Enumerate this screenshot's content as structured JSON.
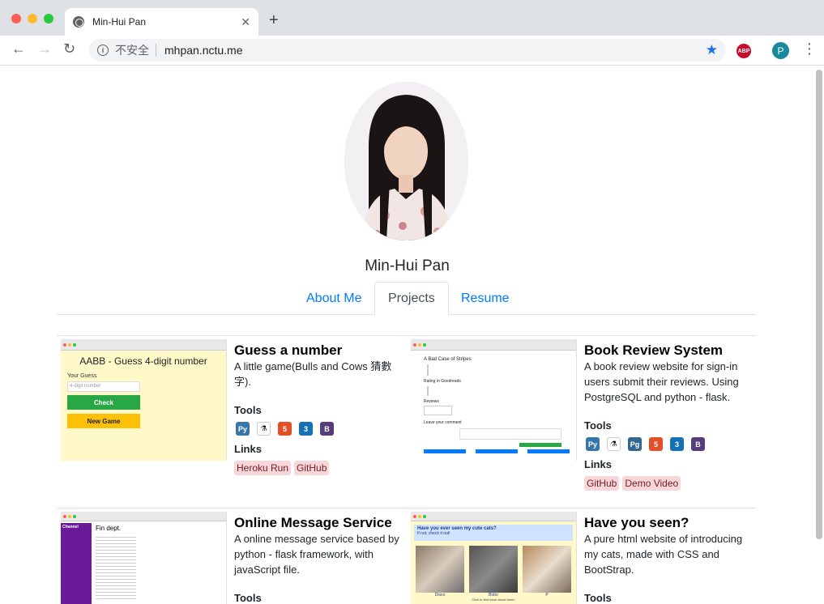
{
  "browser": {
    "tab_title": "Min-Hui Pan",
    "security_label": "不安全",
    "url": "mhpan.nctu.me",
    "abp_label": "ABP",
    "profile_initial": "P"
  },
  "profile": {
    "name": "Min-Hui Pan"
  },
  "nav": {
    "tabs": [
      "About Me",
      "Projects",
      "Resume"
    ],
    "active": "Projects"
  },
  "labels": {
    "tools": "Tools",
    "links": "Links"
  },
  "projects": [
    {
      "title": "Guess a number",
      "description": "A little game(Bulls and Cows 猜數字).",
      "tools": [
        "python-icon",
        "flask-icon",
        "html5-icon",
        "css3-icon",
        "bootstrap-icon"
      ],
      "links": [
        "Heroku Run",
        "GitHub"
      ],
      "thumb": {
        "heading": "AABB - Guess 4-digit number",
        "field_label": "Your Guess",
        "placeholder": "4-digit number",
        "check": "Check",
        "new_game": "New Game"
      }
    },
    {
      "title": "Book Review System",
      "description": "A book review website for sign-in users submit their reviews. Using PostgreSQL and python - flask.",
      "tools": [
        "python-icon",
        "flask-icon",
        "postgresql-icon",
        "html5-icon",
        "css3-icon",
        "bootstrap-icon"
      ],
      "links": [
        "GitHub",
        "Demo Video"
      ],
      "thumb": {
        "heading": "A Bad Case of Stripes",
        "sub1": "Rating in Goodreads",
        "sub2": "Reviews",
        "sub3": "Leave your comment"
      }
    },
    {
      "title": "Online Message Service",
      "description": "A online message service based by python - flask framework, with javaScript file.",
      "tools": [],
      "links": [],
      "thumb": {
        "channel_label": "Channel",
        "header": "Fin dept."
      }
    },
    {
      "title": "Have you seen?",
      "description": "A pure html website of introducing my cats, made with CSS and BootStrap.",
      "tools": [],
      "links": [],
      "thumb": {
        "heading": "Have you ever seen my cute cats?",
        "sub": "If not, check it out!",
        "cats": [
          "Disco",
          "Bobo",
          "P"
        ],
        "footer": "Click to find more about them!"
      }
    }
  ],
  "colors": {
    "link": "#007bff",
    "badge_bg": "#f8d7da",
    "badge_text": "#721c24"
  }
}
